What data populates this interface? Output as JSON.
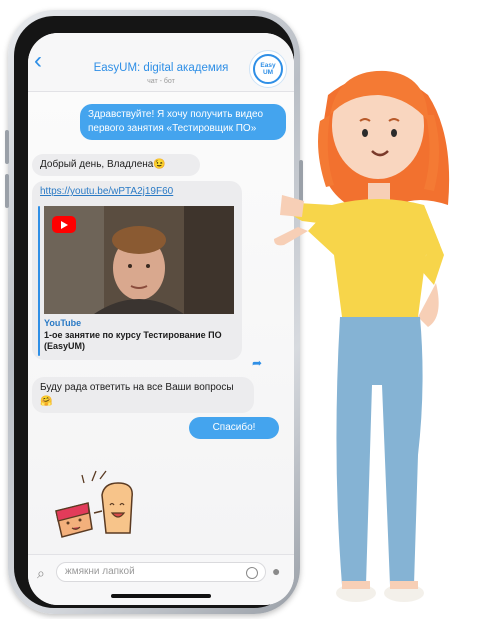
{
  "header": {
    "title": "EasyUM: digital академия",
    "subtitle": "чат - бот",
    "avatar_text": "Easy\nUM"
  },
  "messages": {
    "m1": "Здравствуйте! Я хочу получить видео первого занятия «Тестировщик ПО»",
    "m2": "Добрый день, Владлена😉",
    "link": "https://youtu.be/wPTA2j19F60",
    "preview_source": "YouTube",
    "preview_desc": "1-ое занятие по курсу Тестирование ПО (EasyUM)",
    "m3": "Буду рада ответить на все Ваши вопросы 🤗",
    "m4": "Спасибо!"
  },
  "input": {
    "placeholder": "жмякни лапкой"
  },
  "colors": {
    "accent": "#2f8fe6",
    "outgoing_bubble": "#44a4ee",
    "incoming_bubble": "#ececee",
    "youtube_red": "#ff0000"
  }
}
